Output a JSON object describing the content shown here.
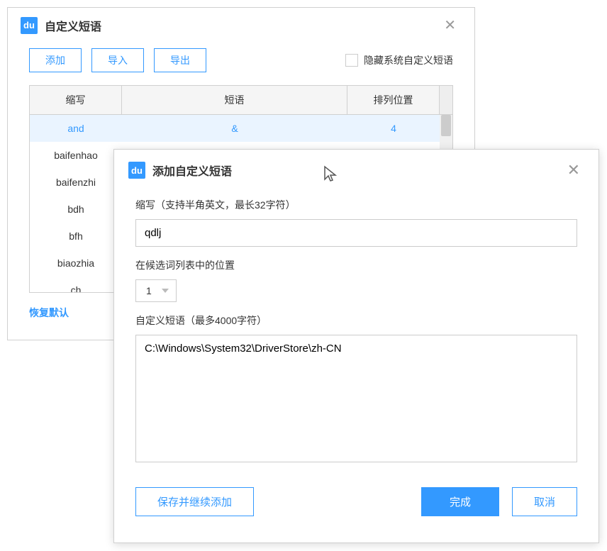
{
  "parent": {
    "title": "自定义短语",
    "toolbar": {
      "add": "添加",
      "import": "导入",
      "export": "导出",
      "hide_system": "隐藏系统自定义短语"
    },
    "table": {
      "headers": {
        "abbr": "缩写",
        "phrase": "短语",
        "position": "排列位置"
      },
      "rows": [
        {
          "abbr": "and",
          "phrase": "&",
          "position": "4",
          "selected": true
        },
        {
          "abbr": "baifenhao",
          "phrase": "",
          "position": ""
        },
        {
          "abbr": "baifenzhi",
          "phrase": "",
          "position": ""
        },
        {
          "abbr": "bdh",
          "phrase": "",
          "position": ""
        },
        {
          "abbr": "bfh",
          "phrase": "",
          "position": ""
        },
        {
          "abbr": "biaozhia",
          "phrase": "",
          "position": ""
        },
        {
          "abbr": "ch",
          "phrase": "",
          "position": ""
        }
      ]
    },
    "restore_default": "恢复默认"
  },
  "modal": {
    "title": "添加自定义短语",
    "labels": {
      "abbr": "缩写（支持半角英文，最长32字符）",
      "position": "在候选词列表中的位置",
      "phrase": "自定义短语（最多4000字符）"
    },
    "values": {
      "abbr": "qdlj",
      "position": "1",
      "phrase": "C:\\Windows\\System32\\DriverStore\\zh-CN"
    },
    "buttons": {
      "save_continue": "保存并继续添加",
      "done": "完成",
      "cancel": "取消"
    }
  }
}
